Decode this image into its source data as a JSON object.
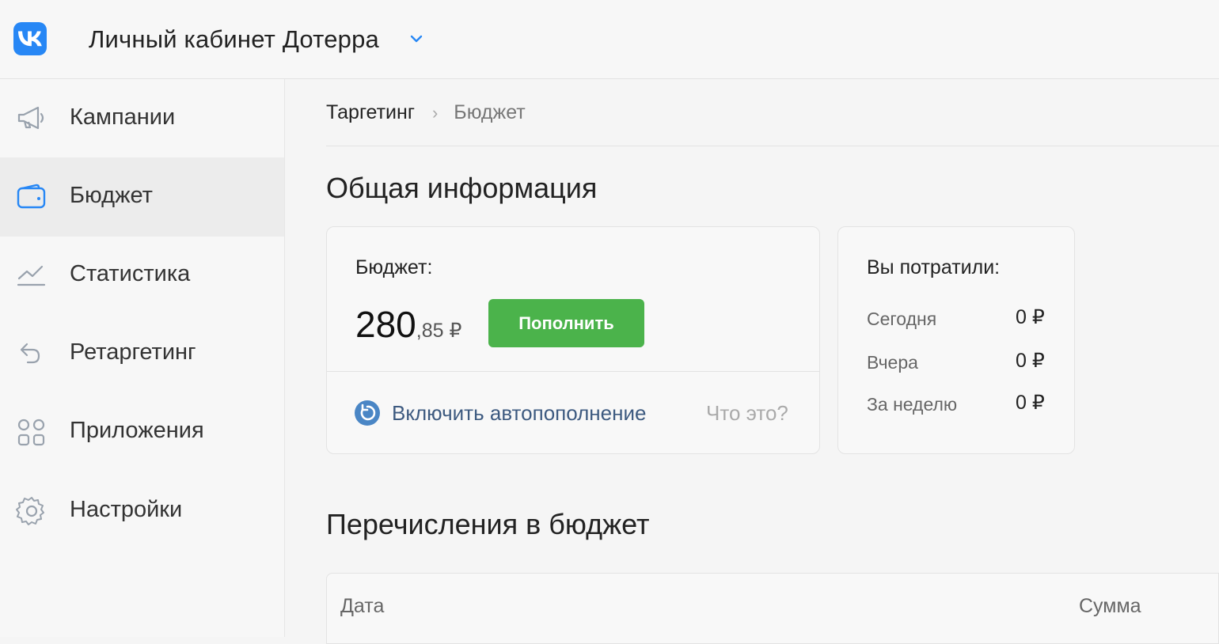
{
  "header": {
    "logo_text": "VK",
    "account_title": "Личный кабинет Дотерра"
  },
  "sidebar": {
    "items": [
      {
        "label": "Кампании",
        "icon": "megaphone-icon",
        "active": false
      },
      {
        "label": "Бюджет",
        "icon": "wallet-icon",
        "active": true
      },
      {
        "label": "Статистика",
        "icon": "chart-icon",
        "active": false
      },
      {
        "label": "Ретаргетинг",
        "icon": "undo-arrow-icon",
        "active": false
      },
      {
        "label": "Приложения",
        "icon": "apps-grid-icon",
        "active": false
      },
      {
        "label": "Настройки",
        "icon": "gear-icon",
        "active": false
      }
    ]
  },
  "breadcrumb": {
    "parent": "Таргетинг",
    "current": "Бюджет"
  },
  "general": {
    "title": "Общая информация",
    "budget": {
      "label": "Бюджет:",
      "amount_int": "280",
      "amount_frac": ",85 ₽",
      "topup_label": "Пополнить",
      "autotopup_label": "Включить автопополнение",
      "what_label": "Что это?"
    },
    "spent": {
      "label": "Вы потратили:",
      "rows": [
        {
          "label": "Сегодня",
          "value": "0 ₽"
        },
        {
          "label": "Вчера",
          "value": "0 ₽"
        },
        {
          "label": "За неделю",
          "value": "0 ₽"
        }
      ]
    }
  },
  "transfers": {
    "title": "Перечисления в бюджет",
    "columns": [
      "Дата",
      "Сумма"
    ]
  },
  "colors": {
    "accent": "#2787f5",
    "button": "#4bb34b",
    "link": "#3d5a80"
  }
}
